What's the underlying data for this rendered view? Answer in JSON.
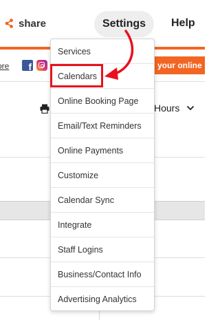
{
  "nav": {
    "share_label": "share",
    "settings_label": "Settings",
    "help_label": "Help"
  },
  "social": {
    "more_link": "ore",
    "facebook_glyph": "f",
    "promo_text": "your online"
  },
  "toolbar": {
    "hours_label": "Hours"
  },
  "settings_menu": {
    "items": [
      {
        "label": "Services"
      },
      {
        "label": "Calendars"
      },
      {
        "label": "Online Booking Page"
      },
      {
        "label": "Email/Text Reminders"
      },
      {
        "label": "Online Payments"
      },
      {
        "label": "Customize"
      },
      {
        "label": "Calendar Sync"
      },
      {
        "label": "Integrate"
      },
      {
        "label": "Staff Logins"
      },
      {
        "label": "Business/Contact Info"
      },
      {
        "label": "Advertising Analytics"
      }
    ],
    "highlighted_item": "Calendars"
  },
  "colors": {
    "brand_orange": "#f26522",
    "annotation_red": "#e8111e",
    "facebook_blue": "#3b5998"
  },
  "icons": {
    "share": "share-icon",
    "print": "printer-icon",
    "dropdown": "chevron-down-icon",
    "facebook": "facebook-icon",
    "instagram": "instagram-icon"
  }
}
